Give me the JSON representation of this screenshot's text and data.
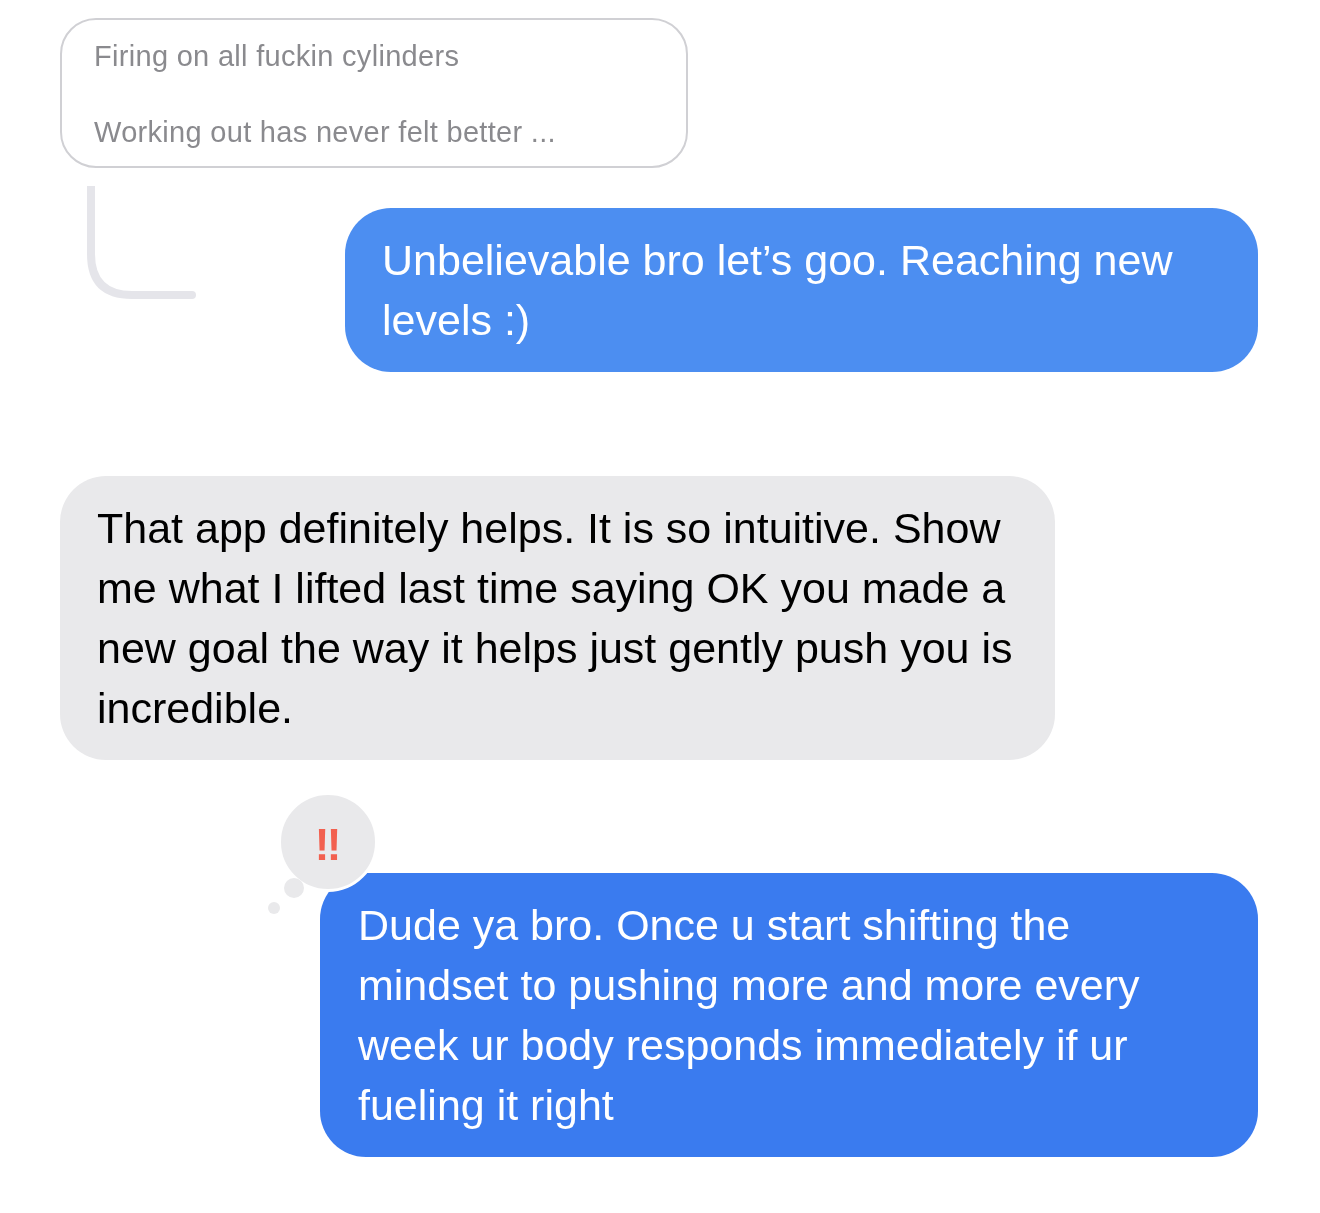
{
  "messages": [
    {
      "kind": "quoted",
      "lines": [
        "Firing on all fuckin cylinders",
        "Working out has never felt better ..."
      ]
    },
    {
      "kind": "sent",
      "text": "Unbelievable bro let’s goo. Reaching new levels :)"
    },
    {
      "kind": "received",
      "text": "That app definitely helps. It is so intuitive. Show me what I lifted last time saying OK you made a new goal the way it helps just gently push you is incredible."
    },
    {
      "kind": "sent",
      "text": "Dude ya bro. Once u start shifting the mindset to pushing more and more every week ur body responds immediately if ur fueling it right",
      "reaction": "‼"
    }
  ]
}
